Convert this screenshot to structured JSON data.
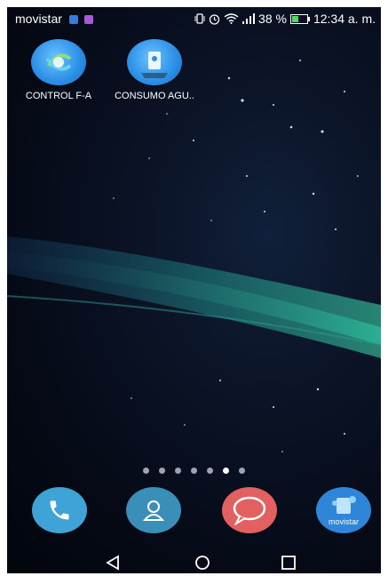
{
  "status_bar": {
    "carrier": "movistar",
    "battery_percent": "38 %",
    "time": "12:34 a. m."
  },
  "apps": [
    {
      "label": "CONTROL F-A",
      "icon": "control-fa-app-icon"
    },
    {
      "label": "CONSUMO AGU..",
      "icon": "consumo-agua-app-icon"
    }
  ],
  "page_indicator": {
    "count": 7,
    "active_index": 5
  },
  "dock": [
    {
      "name": "phone",
      "icon": "phone-icon",
      "color": "#3fa3d6"
    },
    {
      "name": "contacts",
      "icon": "contact-icon",
      "color": "#3a8fb8"
    },
    {
      "name": "messages",
      "icon": "chat-bubble-icon",
      "color": "#e26060"
    },
    {
      "name": "movistar",
      "label": "movistar",
      "icon": "movistar-app-icon",
      "color": "#2f85d8"
    }
  ],
  "nav": [
    "back-icon",
    "home-icon",
    "recents-icon"
  ]
}
